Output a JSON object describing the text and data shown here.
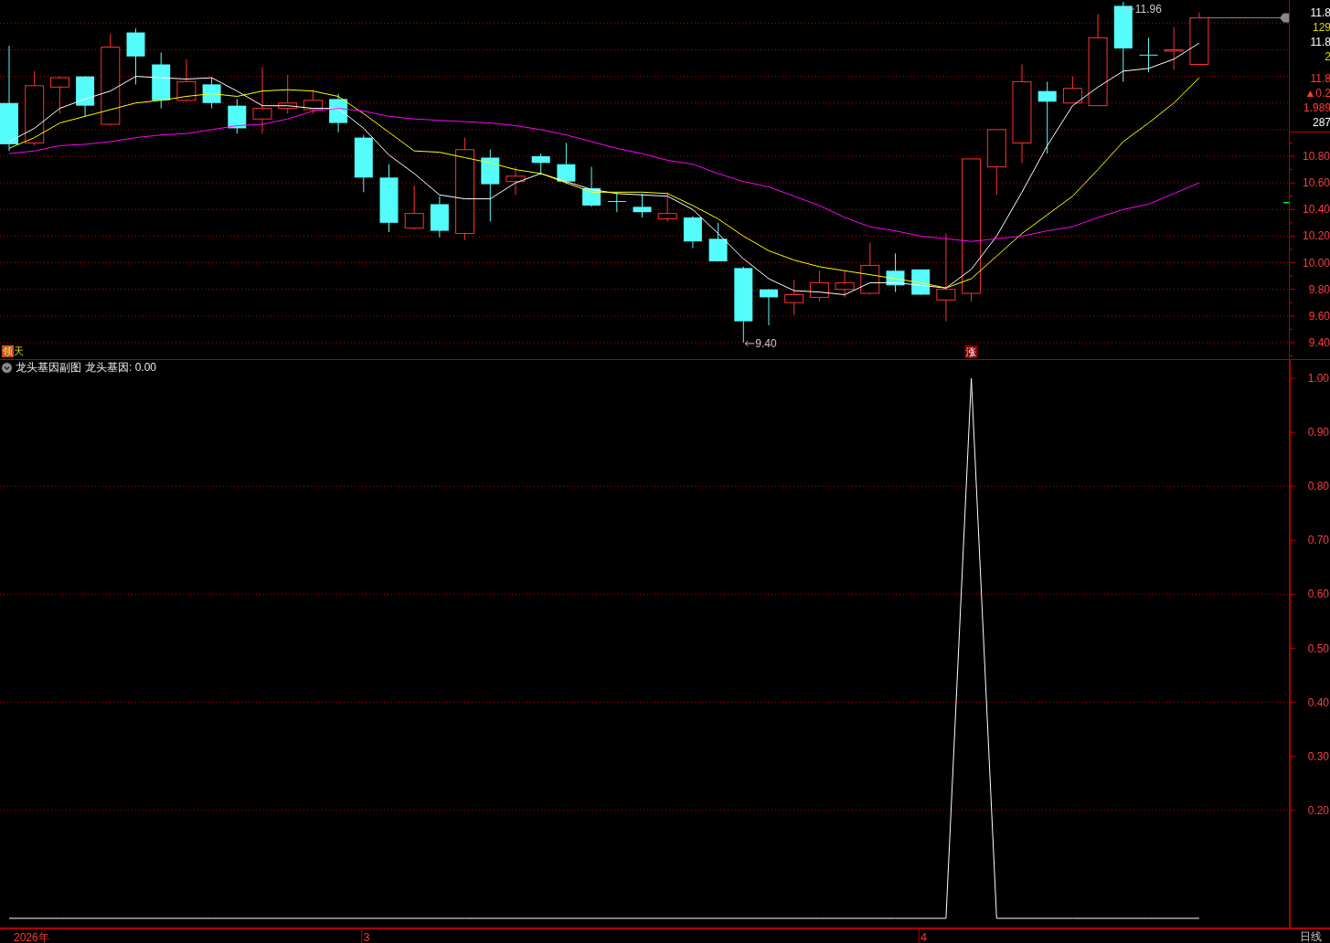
{
  "price_pane": {
    "chart_data": {
      "type": "line",
      "ylim": [
        9.276,
        11.974
      ],
      "grid": true,
      "yticks": [
        {
          "value": 9.4,
          "label": "9.40"
        },
        {
          "value": 9.6,
          "label": "9.60"
        },
        {
          "value": 9.8,
          "label": "9.80"
        },
        {
          "value": 10.0,
          "label": "10.00"
        },
        {
          "value": 10.2,
          "label": "10.20"
        },
        {
          "value": 10.4,
          "label": "10.40"
        },
        {
          "value": 10.6,
          "label": "10.60"
        },
        {
          "value": 10.8,
          "label": "10.80"
        }
      ],
      "series": [
        {
          "color": "#ffffff",
          "values": [
            10.91,
            11.01,
            11.16,
            11.23,
            11.29,
            11.4,
            11.39,
            11.38,
            11.39,
            11.29,
            11.18,
            11.18,
            11.16,
            11.16,
            11.01,
            10.81,
            10.67,
            10.51,
            10.48,
            10.48,
            10.6,
            10.67,
            10.61,
            10.55,
            10.52,
            10.51,
            10.5,
            10.4,
            10.22,
            10.03,
            9.88,
            9.79,
            9.78,
            9.76,
            9.85,
            9.85,
            9.83,
            9.81,
            9.95,
            10.2,
            10.53,
            10.88,
            11.18,
            11.32,
            11.44,
            11.46,
            11.53,
            11.65
          ]
        },
        {
          "color": "#ffff00",
          "values": [
            10.86,
            10.94,
            11.05,
            11.1,
            11.15,
            11.2,
            11.22,
            11.25,
            11.27,
            11.25,
            11.29,
            11.3,
            11.29,
            11.25,
            11.12,
            10.98,
            10.84,
            10.83,
            10.79,
            10.75,
            10.7,
            10.67,
            10.6,
            10.53,
            10.53,
            10.53,
            10.52,
            10.43,
            10.33,
            10.2,
            10.09,
            10.02,
            9.97,
            9.94,
            9.91,
            9.88,
            9.85,
            9.81,
            9.88,
            10.05,
            10.22,
            10.36,
            10.5,
            10.7,
            10.91,
            11.05,
            11.2,
            11.39
          ]
        },
        {
          "color": "#ff00ff",
          "values": [
            10.82,
            10.84,
            10.88,
            10.89,
            10.91,
            10.94,
            10.96,
            10.97,
            11.0,
            11.03,
            11.04,
            11.08,
            11.14,
            11.16,
            11.14,
            11.1,
            11.08,
            11.07,
            11.06,
            11.05,
            11.03,
            11.0,
            10.96,
            10.91,
            10.86,
            10.82,
            10.77,
            10.74,
            10.67,
            10.61,
            10.57,
            10.5,
            10.43,
            10.34,
            10.27,
            10.24,
            10.2,
            10.18,
            10.16,
            10.18,
            10.2,
            10.24,
            10.27,
            10.34,
            10.4,
            10.44,
            10.52,
            10.6
          ]
        }
      ]
    },
    "price_labels": [
      {
        "text": "9.40"
      },
      {
        "text": "11.96"
      }
    ],
    "rise_badge": "涨",
    "signal_label": {
      "badge": "领",
      "text": "天"
    },
    "quote_panel": [
      {
        "text": "11.8",
        "color": "#ffffff"
      },
      {
        "text": "129",
        "color": "#d8d800"
      },
      {
        "text": "11.8",
        "color": "#ffffff"
      },
      {
        "text": "2",
        "color": "#d8d800"
      },
      {
        "text": "11.8",
        "color": "#ff3c3c"
      },
      {
        "text": "▲0.2",
        "color": "#ff3c3c"
      },
      {
        "text": "1.989",
        "color": "#ff3c3c"
      },
      {
        "text": "287",
        "color": "#ffffff"
      }
    ]
  },
  "indicator_pane": {
    "title": "龙头基因副图",
    "value_label": "龙头基因: 0.00",
    "chart_data": {
      "type": "line",
      "ylim": [
        -0.017,
        1.034
      ],
      "grid": true,
      "yticks": [
        {
          "value": 0.2,
          "label": "0.20"
        },
        {
          "value": 0.3,
          "label": "0.30"
        },
        {
          "value": 0.4,
          "label": "0.40"
        },
        {
          "value": 0.5,
          "label": "0.50"
        },
        {
          "value": 0.6,
          "label": "0.60"
        },
        {
          "value": 0.7,
          "label": "0.70"
        },
        {
          "value": 0.8,
          "label": "0.80"
        },
        {
          "value": 0.9,
          "label": "0.90"
        },
        {
          "value": 1.0,
          "label": "1.00"
        }
      ],
      "series": [
        {
          "color": "#ffffff",
          "values": [
            0,
            0,
            0,
            0,
            0,
            0,
            0,
            0,
            0,
            0,
            0,
            0,
            0,
            0,
            0,
            0,
            0,
            0,
            0,
            0,
            0,
            0,
            0,
            0,
            0,
            0,
            0,
            0,
            0,
            0,
            0,
            0,
            0,
            0,
            0,
            0,
            0,
            0,
            1,
            0,
            0,
            0,
            0,
            0,
            0,
            0,
            0,
            0
          ]
        }
      ]
    }
  },
  "date_axis": [
    {
      "text": "2026年"
    },
    {
      "text": "3"
    },
    {
      "text": "4"
    }
  ],
  "period": "日线"
}
